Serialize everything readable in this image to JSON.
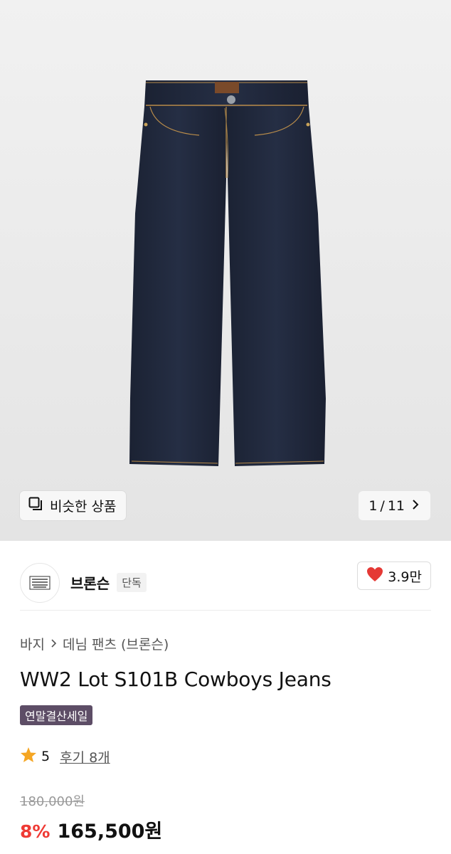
{
  "product_image": {
    "similar_label": "비슷한 상품",
    "pager": {
      "current": "1",
      "separator": "/",
      "total": "11"
    }
  },
  "brand": {
    "name": "브론슨",
    "tag": "단독",
    "likes": "3.9만"
  },
  "breadcrumb": {
    "parent": "바지",
    "category": "데님 팬츠 (브론슨)"
  },
  "product": {
    "title": "WW2 Lot S101B Cowboys Jeans",
    "sale_badge": "연말결산세일",
    "rating": "5",
    "reviews": "후기 8개",
    "original_price": "180,000원",
    "discount": "8%",
    "final_price": "165,500원"
  },
  "colors": {
    "sale_badge_bg": "#5d4d66",
    "discount_red": "#ef3a34",
    "heart_red": "#e53935",
    "star": "#f5a623",
    "denim": "#1e2536"
  },
  "icons": {
    "similar": "similar-products-icon",
    "pager_next": "chevron-right-icon",
    "like": "heart-icon",
    "breadcrumb_sep": "chevron-right-icon",
    "rating": "star-icon"
  }
}
